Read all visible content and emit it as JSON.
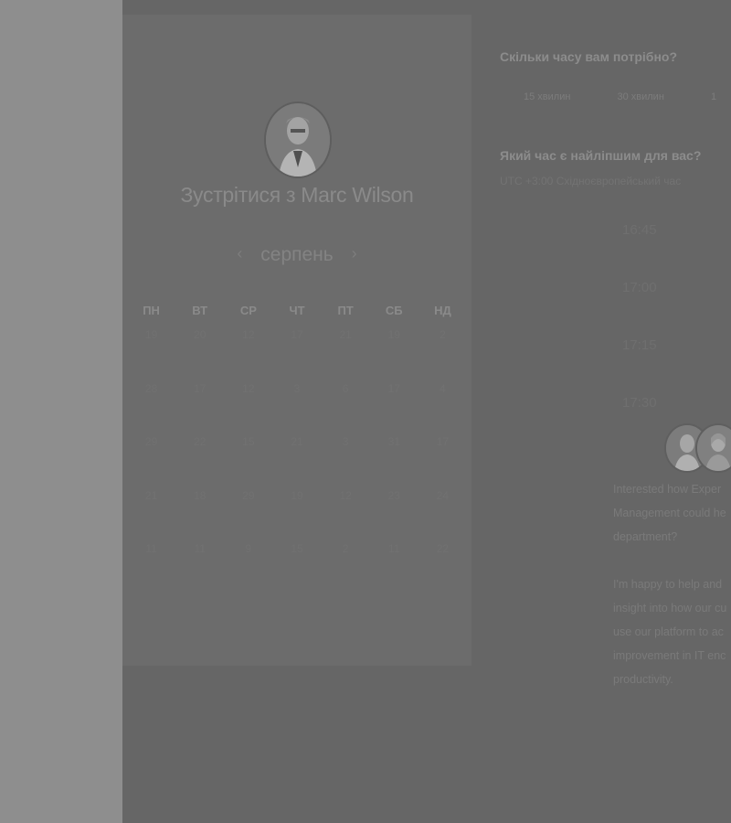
{
  "colors": {
    "overlay": "#666666",
    "page": "#8e8e8e",
    "panel": "#6c6c6c"
  },
  "calendar": {
    "title": "Зустрітися з Marc Wilson",
    "month": "серпень",
    "prev_icon": "chevron-left-icon",
    "next_icon": "chevron-right-icon",
    "weekdays": [
      "ПН",
      "ВТ",
      "СР",
      "ЧТ",
      "ПТ",
      "СБ",
      "НД"
    ],
    "weeks": [
      [
        "19",
        "20",
        "12",
        "17",
        "21",
        "19",
        "2"
      ],
      [
        "28",
        "17",
        "12",
        "3",
        "6",
        "17",
        "4"
      ],
      [
        "29",
        "22",
        "15",
        "21",
        "3",
        "31",
        "17"
      ],
      [
        "21",
        "18",
        "29",
        "19",
        "12",
        "23",
        "24"
      ],
      [
        "11",
        "11",
        "9",
        "15",
        "2",
        "11",
        "22"
      ]
    ]
  },
  "scheduler": {
    "duration_question": "Скільки часу вам потрібно?",
    "durations": [
      "15 хвилин",
      "30 хвилин",
      "1"
    ],
    "time_question": "Який час є найліпшим для вас?",
    "timezone": "UTC +3:00 Східноєвропейський час",
    "slots": [
      "16:45",
      "17:00",
      "17:15",
      "17:30"
    ]
  },
  "promo": {
    "lines_1": [
      "Interested how Exper",
      "Management could he",
      "department?"
    ],
    "lines_2": [
      "I'm happy to help and",
      "insight into how our cu",
      "use our platform to ac",
      "improvement in IT enc",
      "productivity."
    ]
  }
}
